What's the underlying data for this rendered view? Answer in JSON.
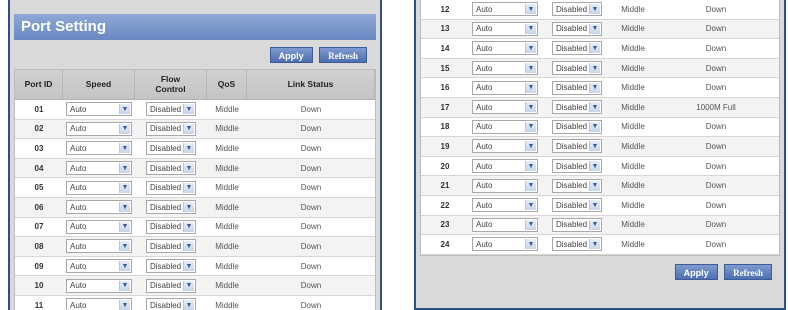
{
  "title": "Port Setting",
  "buttons": {
    "apply": "Apply",
    "refresh": "Refresh"
  },
  "columns": {
    "port_id": "Port ID",
    "speed": "Speed",
    "flow": "Flow Control",
    "qos": "QoS",
    "link": "Link Status"
  },
  "left_rows": [
    {
      "id": "01",
      "speed": "Auto",
      "flow": "Disabled",
      "qos": "Middle",
      "link": "Down"
    },
    {
      "id": "02",
      "speed": "Auto",
      "flow": "Disabled",
      "qos": "Middle",
      "link": "Down"
    },
    {
      "id": "03",
      "speed": "Auto",
      "flow": "Disabled",
      "qos": "Middle",
      "link": "Down"
    },
    {
      "id": "04",
      "speed": "Auto",
      "flow": "Disabled",
      "qos": "Middle",
      "link": "Down"
    },
    {
      "id": "05",
      "speed": "Auto",
      "flow": "Disabled",
      "qos": "Middle",
      "link": "Down"
    },
    {
      "id": "06",
      "speed": "Auto",
      "flow": "Disabled",
      "qos": "Middle",
      "link": "Down"
    },
    {
      "id": "07",
      "speed": "Auto",
      "flow": "Disabled",
      "qos": "Middle",
      "link": "Down"
    },
    {
      "id": "08",
      "speed": "Auto",
      "flow": "Disabled",
      "qos": "Middle",
      "link": "Down"
    },
    {
      "id": "09",
      "speed": "Auto",
      "flow": "Disabled",
      "qos": "Middle",
      "link": "Down"
    },
    {
      "id": "10",
      "speed": "Auto",
      "flow": "Disabled",
      "qos": "Middle",
      "link": "Down"
    },
    {
      "id": "11",
      "speed": "Auto",
      "flow": "Disabled",
      "qos": "Middle",
      "link": "Down"
    }
  ],
  "right_rows": [
    {
      "id": "12",
      "speed": "Auto",
      "flow": "Disabled",
      "qos": "Middle",
      "link": "Down"
    },
    {
      "id": "13",
      "speed": "Auto",
      "flow": "Disabled",
      "qos": "Middle",
      "link": "Down"
    },
    {
      "id": "14",
      "speed": "Auto",
      "flow": "Disabled",
      "qos": "Middle",
      "link": "Down"
    },
    {
      "id": "15",
      "speed": "Auto",
      "flow": "Disabled",
      "qos": "Middle",
      "link": "Down"
    },
    {
      "id": "16",
      "speed": "Auto",
      "flow": "Disabled",
      "qos": "Middle",
      "link": "Down"
    },
    {
      "id": "17",
      "speed": "Auto",
      "flow": "Disabled",
      "qos": "Middle",
      "link": "1000M Full"
    },
    {
      "id": "18",
      "speed": "Auto",
      "flow": "Disabled",
      "qos": "Middle",
      "link": "Down"
    },
    {
      "id": "19",
      "speed": "Auto",
      "flow": "Disabled",
      "qos": "Middle",
      "link": "Down"
    },
    {
      "id": "20",
      "speed": "Auto",
      "flow": "Disabled",
      "qos": "Middle",
      "link": "Down"
    },
    {
      "id": "21",
      "speed": "Auto",
      "flow": "Disabled",
      "qos": "Middle",
      "link": "Down"
    },
    {
      "id": "22",
      "speed": "Auto",
      "flow": "Disabled",
      "qos": "Middle",
      "link": "Down"
    },
    {
      "id": "23",
      "speed": "Auto",
      "flow": "Disabled",
      "qos": "Middle",
      "link": "Down"
    },
    {
      "id": "24",
      "speed": "Auto",
      "flow": "Disabled",
      "qos": "Middle",
      "link": "Down"
    }
  ],
  "icons": {
    "dropdown": "chevron-down-icon"
  },
  "colors": {
    "frame": "#2f4e88",
    "title_bg": "#7592c9",
    "button_bg": "#5a7bbd"
  }
}
